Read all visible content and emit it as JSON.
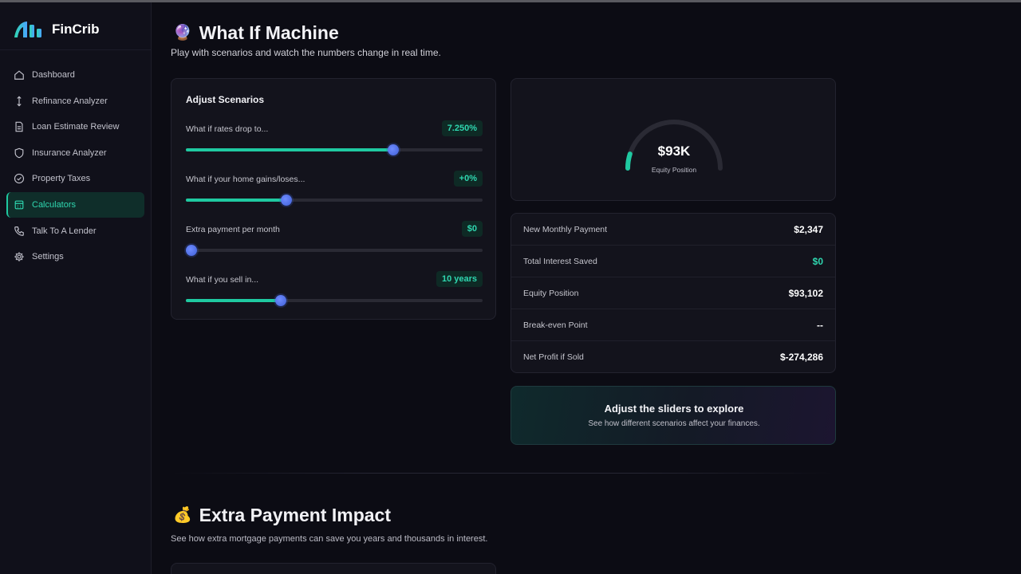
{
  "app": {
    "name": "FinCrib"
  },
  "sidebar": {
    "items": [
      {
        "label": "Dashboard",
        "icon": "home-icon",
        "active": false
      },
      {
        "label": "Refinance Analyzer",
        "icon": "arrows-vertical-icon",
        "active": false
      },
      {
        "label": "Loan Estimate Review",
        "icon": "document-icon",
        "active": false
      },
      {
        "label": "Insurance Analyzer",
        "icon": "shield-icon",
        "active": false
      },
      {
        "label": "Property Taxes",
        "icon": "check-circle-icon",
        "active": false
      },
      {
        "label": "Calculators",
        "icon": "calculator-icon",
        "active": true
      },
      {
        "label": "Talk To A Lender",
        "icon": "phone-icon",
        "active": false
      },
      {
        "label": "Settings",
        "icon": "gear-icon",
        "active": false
      }
    ]
  },
  "what_if": {
    "emoji": "🔮",
    "title": "What If Machine",
    "subtitle": "Play with scenarios and watch the numbers change in real time.",
    "scenarios": {
      "title": "Adjust Scenarios",
      "sliders": [
        {
          "label": "What if rates drop to...",
          "value": "7.250%",
          "fraction": 0.7
        },
        {
          "label": "What if your home gains/loses...",
          "value": "+0%",
          "fraction": 0.34
        },
        {
          "label": "Extra payment per month",
          "value": "$0",
          "fraction": 0.02
        },
        {
          "label": "What if you sell in...",
          "value": "10 years",
          "fraction": 0.32
        }
      ]
    },
    "gauge": {
      "value": "$93K",
      "label": "Equity Position",
      "fraction": 0.1
    },
    "metrics": [
      {
        "label": "New Monthly Payment",
        "value": "$2,347",
        "highlight": false
      },
      {
        "label": "Total Interest Saved",
        "value": "$0",
        "highlight": true
      },
      {
        "label": "Equity Position",
        "value": "$93,102",
        "highlight": false
      },
      {
        "label": "Break-even Point",
        "value": "--",
        "highlight": false
      },
      {
        "label": "Net Profit if Sold",
        "value": "$-274,286",
        "highlight": false
      }
    ],
    "explore": {
      "title": "Adjust the sliders to explore",
      "subtitle": "See how different scenarios affect your finances."
    }
  },
  "extra_payment": {
    "emoji": "💰",
    "title": "Extra Payment Impact",
    "subtitle": "See how extra mortgage payments can save you years and thousands in interest."
  },
  "colors": {
    "accent": "#1fc9a1",
    "thumb": "#4f6fe8",
    "background": "#0c0c14",
    "card": "#13131c"
  }
}
